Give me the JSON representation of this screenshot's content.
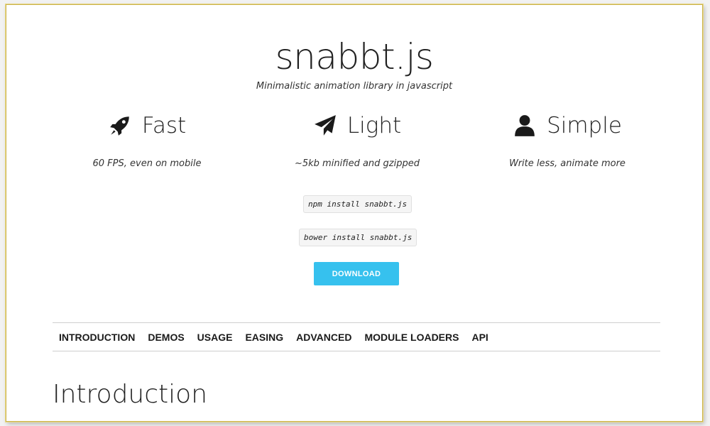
{
  "header": {
    "title": "snabbt.js",
    "subtitle": "Minimalistic animation library in javascript"
  },
  "features": [
    {
      "icon": "rocket-icon",
      "label": "Fast",
      "description": "60 FPS, even on mobile"
    },
    {
      "icon": "paper-plane-icon",
      "label": "Light",
      "description": "~5kb minified and gzipped"
    },
    {
      "icon": "user-icon",
      "label": "Simple",
      "description": "Write less, animate more"
    }
  ],
  "install": {
    "npm": "npm install snabbt.js",
    "bower": "bower install snabbt.js"
  },
  "download_label": "DOWNLOAD",
  "nav": [
    "INTRODUCTION",
    "DEMOS",
    "USAGE",
    "EASING",
    "ADVANCED",
    "MODULE LOADERS",
    "API"
  ],
  "section": {
    "heading": "Introduction"
  },
  "colors": {
    "accent": "#36c1ee",
    "text": "#222222",
    "code_bg": "#f5f5f5"
  }
}
